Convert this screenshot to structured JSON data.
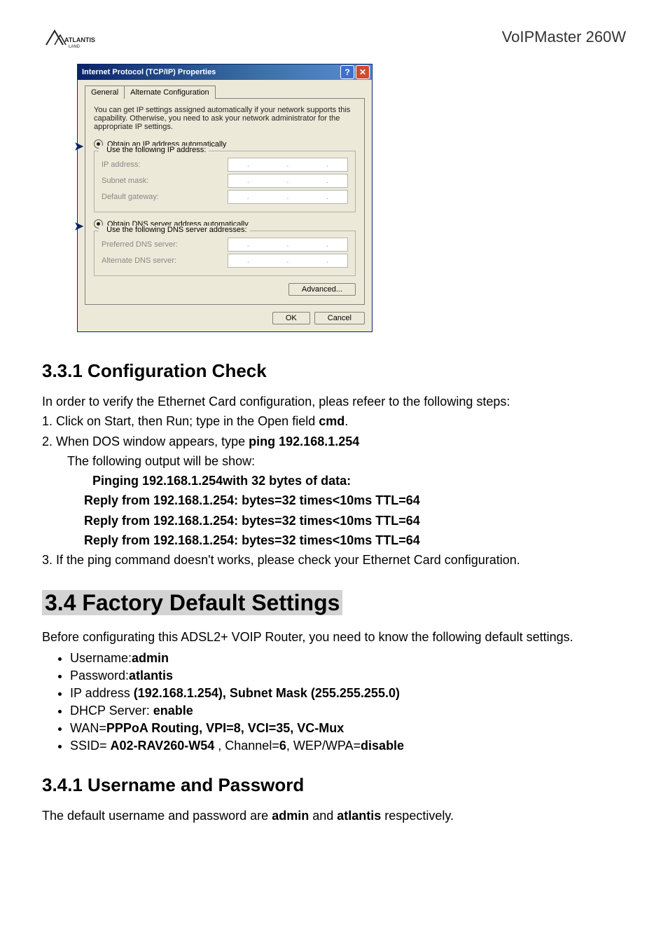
{
  "header": {
    "logo_text": "ATLANTIS",
    "product": "VoIPMaster 260W"
  },
  "dialog": {
    "title": "Internet Protocol (TCP/IP) Properties",
    "help_label": "?",
    "close_label": "✕",
    "tabs": {
      "general": "General",
      "alternate": "Alternate Configuration"
    },
    "info": "You can get IP settings assigned automatically if your network supports this capability. Otherwise, you need to ask your network administrator for the appropriate IP settings.",
    "ip_auto": "Obtain an IP address automatically",
    "ip_manual": "Use the following IP address:",
    "labels": {
      "ip": "IP address:",
      "subnet": "Subnet mask:",
      "gateway": "Default gateway:",
      "pref_dns": "Preferred DNS server:",
      "alt_dns": "Alternate DNS server:"
    },
    "dns_auto": "Obtain DNS server address automatically",
    "dns_manual": "Use the following DNS server addresses:",
    "buttons": {
      "advanced": "Advanced...",
      "ok": "OK",
      "cancel": "Cancel"
    }
  },
  "sections": {
    "s331": {
      "title": "3.3.1 Configuration Check",
      "intro": "In order to verify the Ethernet Card configuration, pleas refeer to the following steps:",
      "step1_prefix": "1. Click on Start, then Run; type in the Open field ",
      "step1_bold": "cmd",
      "step1_suffix": ".",
      "step2_prefix": "2. When DOS window appears, type ",
      "step2_bold": "ping 192.168.1.254",
      "step2_sub": "The following output will be show:",
      "ping_line1": "Pinging 192.168.1.254with 32 bytes of data:",
      "reply1": "Reply from 192.168.1.254: bytes=32 times<10ms TTL=64",
      "reply2": "Reply from 192.168.1.254: bytes=32 times<10ms TTL=64",
      "reply3": "Reply from 192.168.1.254: bytes=32 times<10ms TTL=64",
      "step3": "3. If the ping command doesn't works, please check your Ethernet Card configuration."
    },
    "s34": {
      "title": "3.4 Factory Default Settings",
      "intro": "Before configurating this ADSL2+ VOIP Router, you need to know the following default settings.",
      "items": {
        "u_label": "Username:",
        "u_val": "admin",
        "p_label": "Password:",
        "p_val": "atlantis",
        "ip_label": "IP address ",
        "ip_val": "(192.168.1.254), Subnet Mask (255.255.255.0)",
        "dhcp_label": "DHCP Server: ",
        "dhcp_val": "enable",
        "wan_label": "WAN=",
        "wan_val": "PPPoA Routing, VPI=8, VCI=35, VC-Mux",
        "ssid_label": "SSID= ",
        "ssid_val": "A02-RAV260-W54",
        "ssid_mid": " , Channel=",
        "ch_val": "6",
        "ssid_mid2": ", WEP/WPA=",
        "wep_val": "disable"
      }
    },
    "s341": {
      "title": "3.4.1 Username and Password",
      "text_pre": "The default username and password are ",
      "text_b1": "admin",
      "text_mid": " and ",
      "text_b2": "atlantis",
      "text_post": " respectively."
    }
  }
}
